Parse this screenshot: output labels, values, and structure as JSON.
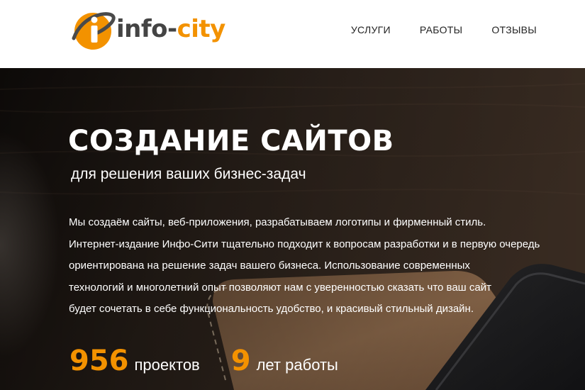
{
  "brand": {
    "logo_text_prefix": "info-",
    "logo_text_accent": "city",
    "logo_icon": "info-i-orbit-icon",
    "accent_color": "#f39200"
  },
  "nav": {
    "items": [
      {
        "label": "УСЛУГИ"
      },
      {
        "label": "РАБОТЫ"
      },
      {
        "label": "ОТЗЫВЫ"
      }
    ]
  },
  "hero": {
    "title": "СОЗДАНИЕ САЙТОВ",
    "subtitle": "для решения ваших бизнес-задач",
    "description_lines": [
      "Мы создаём сайты, веб-приложения, разрабатываем логотипы и фирменный стиль.",
      "Интернет-издание Инфо-Сити тщательно подходит к вопросам разработки и в первую очередь",
      "ориентирована  на решение задач вашего бизнеса. Использование современных",
      "технологий и многолетний опыт позволяют нам с уверенностью сказать что ваш сайт",
      "будет сочетать в себе функциональность удобство, и красивый стильный дизайн."
    ]
  },
  "stats": [
    {
      "number": "956",
      "label": "проектов"
    },
    {
      "number": "9",
      "label": "лет работы"
    }
  ]
}
